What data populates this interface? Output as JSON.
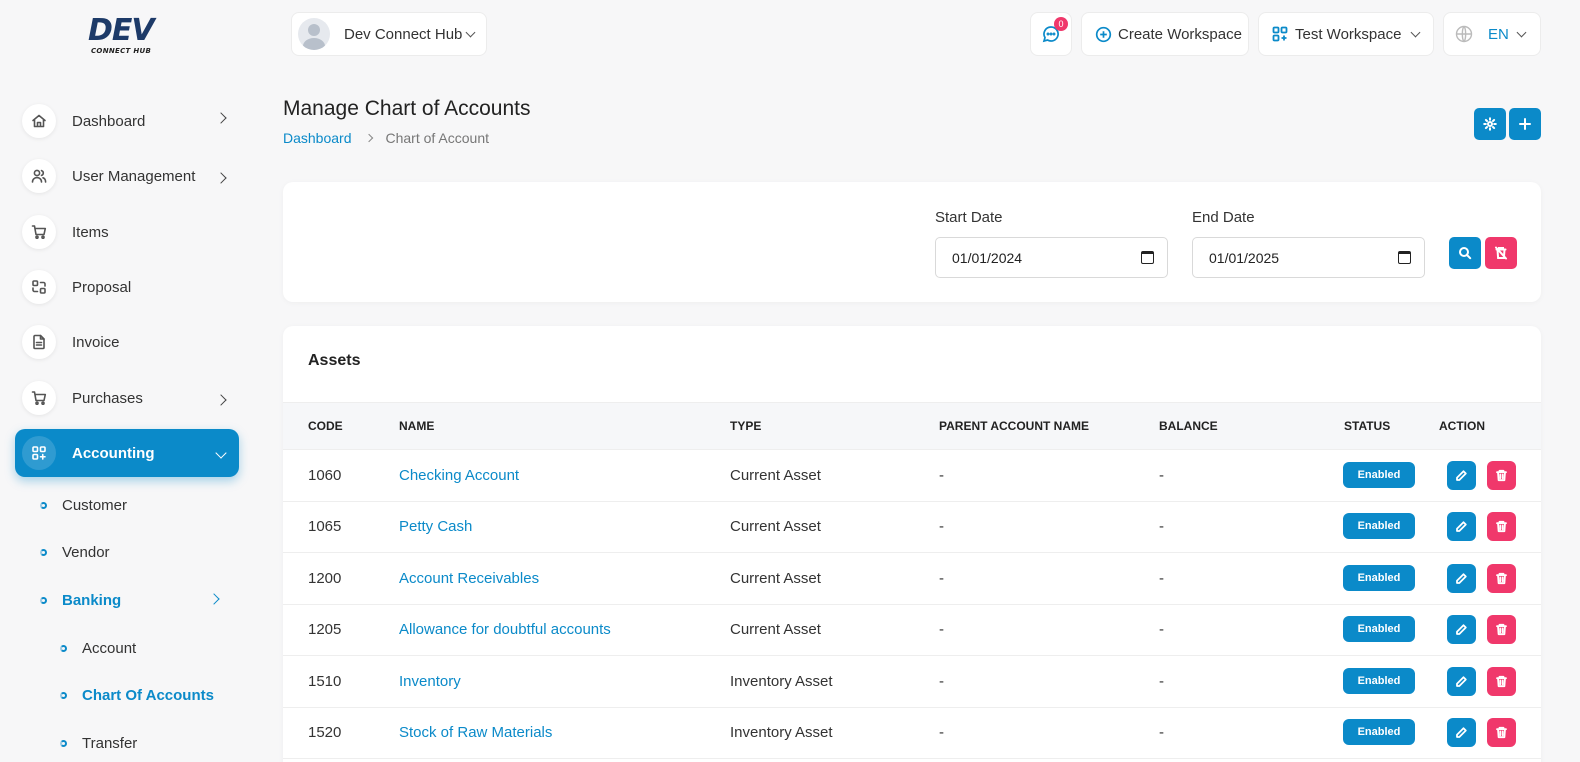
{
  "logo": {
    "main": "DEV",
    "sub": "CONNECT HUB"
  },
  "sidebar": {
    "items": [
      {
        "label": "Dashboard",
        "icon": "home-icon"
      },
      {
        "label": "User Management",
        "icon": "users-icon"
      },
      {
        "label": "Items",
        "icon": "cart-icon"
      },
      {
        "label": "Proposal",
        "icon": "proposal-icon"
      },
      {
        "label": "Invoice",
        "icon": "file-icon"
      },
      {
        "label": "Purchases",
        "icon": "cart-icon"
      },
      {
        "label": "Accounting",
        "icon": "apps-icon"
      }
    ],
    "sub_items": [
      {
        "label": "Customer"
      },
      {
        "label": "Vendor"
      },
      {
        "label": "Banking"
      },
      {
        "label": "Account"
      },
      {
        "label": "Chart Of Accounts"
      },
      {
        "label": "Transfer"
      }
    ]
  },
  "header": {
    "workspace_user": "Dev Connect Hub",
    "messages_count": "0",
    "create_workspace": "Create Workspace",
    "current_workspace": "Test Workspace",
    "language": "EN"
  },
  "page": {
    "title": "Manage Chart of Accounts",
    "breadcrumb_home": "Dashboard",
    "breadcrumb_current": "Chart of Account"
  },
  "filter": {
    "start_label": "Start Date",
    "start_value": "01/01/2024",
    "end_label": "End Date",
    "end_value": "01/01/2025"
  },
  "table": {
    "title": "Assets",
    "headers": [
      "CODE",
      "NAME",
      "TYPE",
      "PARENT ACCOUNT NAME",
      "BALANCE",
      "STATUS",
      "ACTION"
    ],
    "rows": [
      {
        "code": "1060",
        "name": "Checking Account",
        "type": "Current Asset",
        "parent": "-",
        "balance": "-",
        "status": "Enabled"
      },
      {
        "code": "1065",
        "name": "Petty Cash",
        "type": "Current Asset",
        "parent": "-",
        "balance": "-",
        "status": "Enabled"
      },
      {
        "code": "1200",
        "name": "Account Receivables",
        "type": "Current Asset",
        "parent": "-",
        "balance": "-",
        "status": "Enabled"
      },
      {
        "code": "1205",
        "name": "Allowance for doubtful accounts",
        "type": "Current Asset",
        "parent": "-",
        "balance": "-",
        "status": "Enabled"
      },
      {
        "code": "1510",
        "name": "Inventory",
        "type": "Inventory Asset",
        "parent": "-",
        "balance": "-",
        "status": "Enabled"
      },
      {
        "code": "1520",
        "name": "Stock of Raw Materials",
        "type": "Inventory Asset",
        "parent": "-",
        "balance": "-",
        "status": "Enabled"
      }
    ]
  },
  "colors": {
    "accent": "#0b8ac9",
    "danger": "#f0386b"
  }
}
